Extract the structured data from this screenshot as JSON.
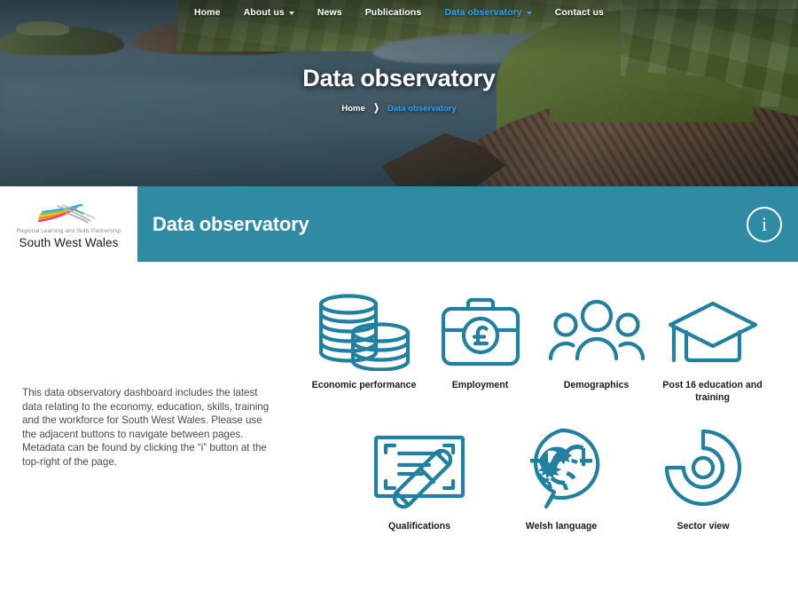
{
  "nav": {
    "items": [
      {
        "label": "Home",
        "caret": false,
        "active": false
      },
      {
        "label": "About us",
        "caret": true,
        "active": false
      },
      {
        "label": "News",
        "caret": false,
        "active": false
      },
      {
        "label": "Publications",
        "caret": false,
        "active": false
      },
      {
        "label": "Data observatory",
        "caret": true,
        "active": true
      },
      {
        "label": "Contact us",
        "caret": false,
        "active": false
      }
    ]
  },
  "hero": {
    "title": "Data observatory",
    "breadcrumb": {
      "home": "Home",
      "separator": "❯",
      "current": "Data observatory"
    }
  },
  "logo": {
    "subtitle": "Regional Learning and Skills Partnership",
    "title": "South West Wales",
    "swoosh_colors": [
      "#e5308a",
      "#f07f1a",
      "#f5c518",
      "#8cc63f",
      "#29abe2",
      "#9a9a9a",
      "#b5b5b5"
    ]
  },
  "banner": {
    "title": "Data observatory",
    "info_label": "i",
    "color": "#2f8aa3"
  },
  "main": {
    "intro": "This data observatory dashboard includes the latest data relating to the economy, education, skills, training and the workforce for South West Wales. Please use the adjacent buttons to navigate between pages. Metadata can be found by clicking the “i” button at the top-right of the page.",
    "icon_color": "#2180a0",
    "tiles_row1": [
      {
        "label": "Economic performance",
        "icon": "coins-icon"
      },
      {
        "label": "Employment",
        "icon": "briefcase-pound-icon"
      },
      {
        "label": "Demographics",
        "icon": "people-group-icon"
      },
      {
        "label": "Post 16 education and training",
        "icon": "graduation-cap-icon"
      }
    ],
    "tiles_row2": [
      {
        "label": "Qualifications",
        "icon": "certificate-scroll-icon"
      },
      {
        "label": "Welsh language",
        "icon": "speech-bubble-dragon-icon"
      },
      {
        "label": "Sector view",
        "icon": "donut-chart-icon"
      }
    ]
  }
}
